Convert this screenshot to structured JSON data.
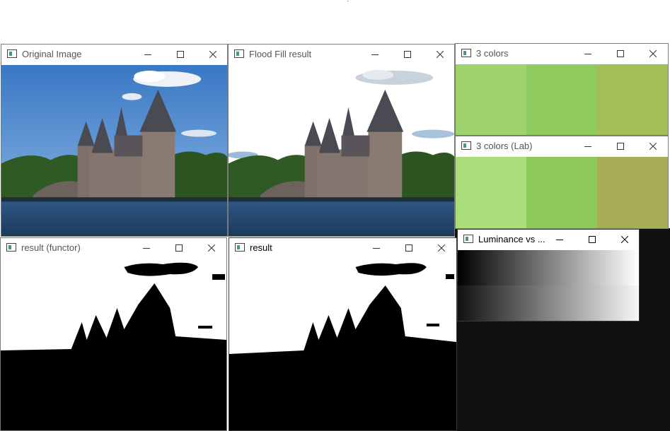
{
  "windows": [
    {
      "id": "original",
      "title": "Original Image",
      "icon": "opencv-window-icon"
    },
    {
      "id": "flood",
      "title": "Flood Fill result",
      "icon": "opencv-window-icon"
    },
    {
      "id": "colors3",
      "title": "3 colors",
      "icon": "opencv-window-icon",
      "swatches": [
        "#9ed26d",
        "#8fca5e",
        "#a3bd57"
      ]
    },
    {
      "id": "colorslab",
      "title": "3 colors (Lab)",
      "icon": "opencv-window-icon",
      "swatches": [
        "#a8dd7a",
        "#8dc85c",
        "#a7ae55"
      ]
    },
    {
      "id": "functor",
      "title": "result (functor)",
      "icon": "opencv-window-icon"
    },
    {
      "id": "result",
      "title": "result",
      "icon": "opencv-window-icon"
    },
    {
      "id": "luminance",
      "title": "Luminance vs ...",
      "icon": "opencv-window-icon"
    }
  ],
  "controls": {
    "minimize": "minimize-icon",
    "maximize": "maximize-icon",
    "close": "close-icon"
  },
  "colors": {
    "sky": "#3f7fc6",
    "water": "#24486e",
    "trees": "#2e5a24",
    "stone": "#7a6c66",
    "roof": "#4a4a52",
    "desktop_dark": "#111111"
  }
}
